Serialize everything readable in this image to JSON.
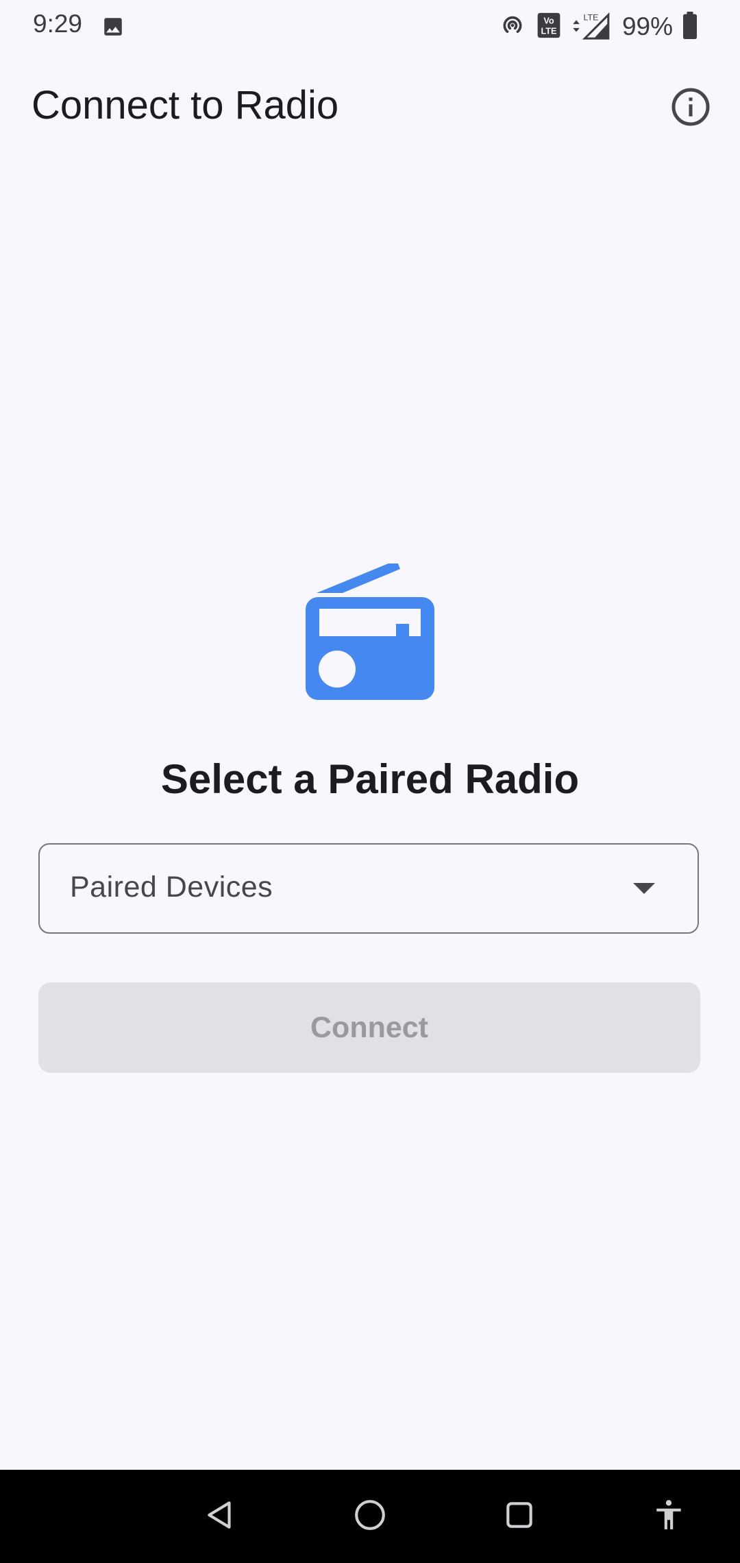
{
  "status_bar": {
    "time": "9:29",
    "battery_text": "99%",
    "icons": [
      "gallery-icon",
      "hotspot-icon",
      "volte-icon",
      "lte-signal-icon",
      "battery-icon"
    ]
  },
  "app_bar": {
    "title": "Connect to Radio",
    "info_icon": "info-icon"
  },
  "main": {
    "illustration_icon": "radio-icon",
    "heading": "Select a Paired Radio",
    "dropdown": {
      "selected_text": "Paired Devices"
    },
    "connect_button": {
      "label": "Connect",
      "enabled": false
    }
  },
  "nav_bar": {
    "icons": [
      "back-icon",
      "home-icon",
      "recents-icon",
      "accessibility-icon"
    ]
  },
  "colors": {
    "background": "#f8f7fd",
    "accent": "#4588f0",
    "button_disabled_bg": "#e1e0e5",
    "button_disabled_text": "#9a999e",
    "text_primary": "#1c1b1f"
  }
}
